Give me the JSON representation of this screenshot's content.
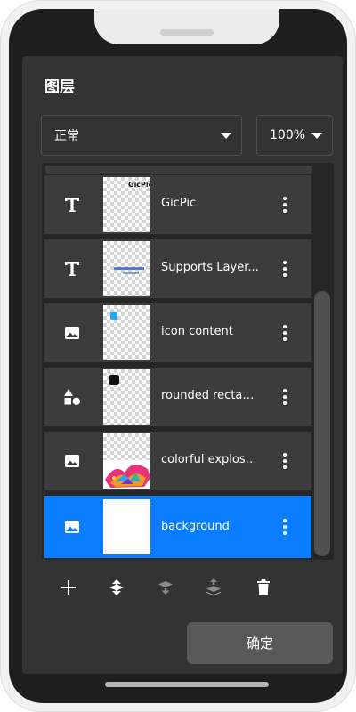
{
  "dialog": {
    "title": "图层",
    "blend_mode": {
      "value": "正常"
    },
    "opacity": {
      "value": "100%"
    },
    "ok_label": "确定"
  },
  "layers": [
    {
      "label": "GicPic",
      "type_icon": "text-icon",
      "thumb_text": "GicPic",
      "selected": false
    },
    {
      "label": "Supports Layer...",
      "type_icon": "text-icon",
      "selected": false
    },
    {
      "label": "icon content",
      "type_icon": "image-icon",
      "selected": false
    },
    {
      "label": "rounded rectan...",
      "type_icon": "shapes-icon",
      "selected": false
    },
    {
      "label": "colorful explosi...",
      "type_icon": "image-icon",
      "selected": false
    },
    {
      "label": "background",
      "type_icon": "image-icon",
      "selected": true
    }
  ],
  "toolbar": [
    {
      "icon": "add-icon",
      "enabled": true
    },
    {
      "icon": "move-layer-icon",
      "enabled": true
    },
    {
      "icon": "merge-down-icon",
      "enabled": false
    },
    {
      "icon": "flatten-icon",
      "enabled": false
    },
    {
      "icon": "delete-icon",
      "enabled": true
    }
  ],
  "colors": {
    "accent": "#0a7cff",
    "dialog_bg": "#333333",
    "row_bg": "#3c3c3c",
    "button_bg": "#595959"
  }
}
